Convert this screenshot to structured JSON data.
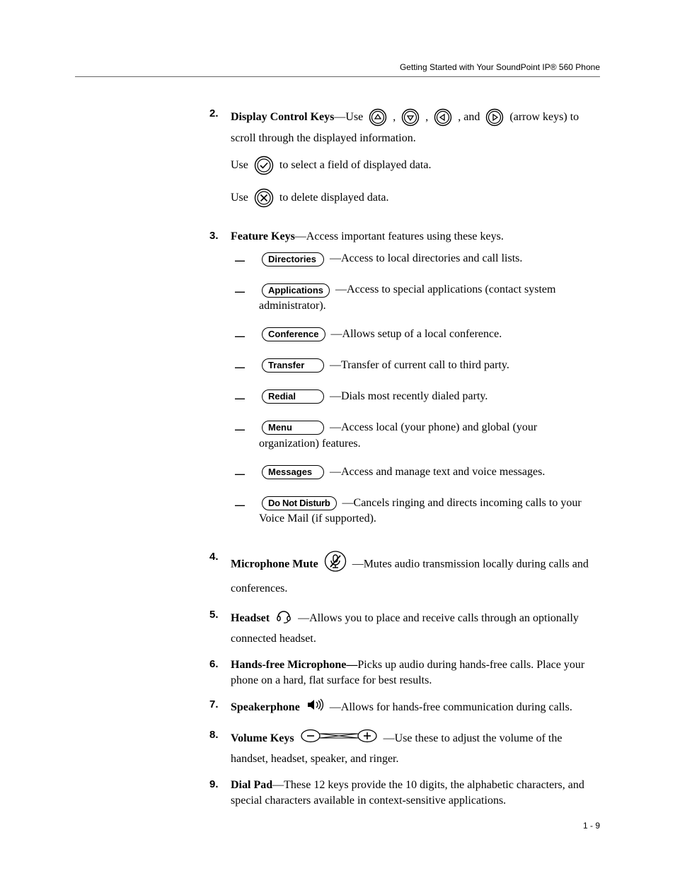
{
  "header": {
    "running_head": "Getting Started with Your SoundPoint IP® 560 Phone"
  },
  "items": {
    "2": {
      "num": "2.",
      "lead": "Display Control Keys",
      "textA": "—Use",
      "mid1": ",",
      "mid2": ",",
      "mid3": ", and",
      "textB": "(arrow keys) to scroll through the displayed information.",
      "line2a": "Use",
      "line2b": "to select a field of displayed data.",
      "line3a": "Use",
      "line3b": "to delete displayed data."
    },
    "3": {
      "num": "3.",
      "lead": "Feature Keys",
      "text": "—Access important features using these keys.",
      "features": [
        {
          "label": "Directories",
          "desc": "—Access to local directories and call lists."
        },
        {
          "label": "Applications",
          "desc": "—Access to special applications (contact system administrator)."
        },
        {
          "label": "Conference",
          "desc": "—Allows setup of a local conference."
        },
        {
          "label": "Transfer",
          "desc": "—Transfer of current call to third party."
        },
        {
          "label": "Redial",
          "desc": "—Dials most recently dialed party."
        },
        {
          "label": "Menu",
          "desc": "—Access local (your phone) and global (your organization) features."
        },
        {
          "label": "Messages",
          "desc": "—Access and manage text and voice messages."
        },
        {
          "label": "Do Not Disturb",
          "desc": "—Cancels ringing and directs incoming calls to your Voice Mail (if supported)."
        }
      ]
    },
    "4": {
      "num": "4.",
      "lead": "Microphone Mute",
      "desc": "—Mutes audio transmission locally during calls and conferences."
    },
    "5": {
      "num": "5.",
      "lead": "Headset",
      "desc": "—Allows you to place and receive calls through an optionally connected headset."
    },
    "6": {
      "num": "6.",
      "lead": "Hands-free Microphone—",
      "desc": "Picks up audio during hands-free calls. Place your phone on a hard, flat surface for best results."
    },
    "7": {
      "num": "7.",
      "lead": "Speakerphone",
      "desc": "—Allows for hands-free communication during calls."
    },
    "8": {
      "num": "8.",
      "lead": "Volume Keys",
      "desc": "—Use these to adjust the volume of the handset, headset, speaker, and ringer."
    },
    "9": {
      "num": "9.",
      "lead": "Dial Pad",
      "desc": "—These 12 keys provide the 10 digits, the alphabetic characters, and special characters available in context-sensitive applications."
    }
  },
  "dash": "—",
  "footer": {
    "page": "1 - 9"
  }
}
